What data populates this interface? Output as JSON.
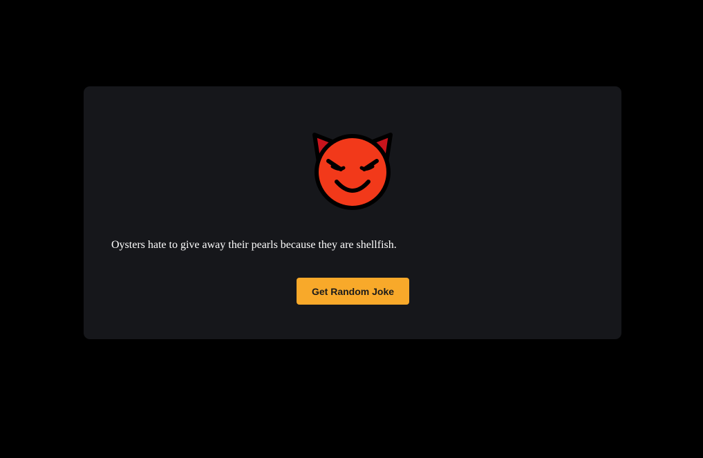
{
  "joke": {
    "icon": "smiling-devil-face-icon",
    "text": "Oysters hate to give away their pearls because they are shellfish."
  },
  "button": {
    "label": "Get Random Joke"
  },
  "colors": {
    "page_background": "#000000",
    "card_background": "#16171b",
    "button_background": "#f8a92a",
    "button_text": "#1a1a1a",
    "joke_text": "#ffffff",
    "emoji_face": "#f2391a",
    "emoji_horn": "#c8141c",
    "emoji_outline": "#000000"
  }
}
